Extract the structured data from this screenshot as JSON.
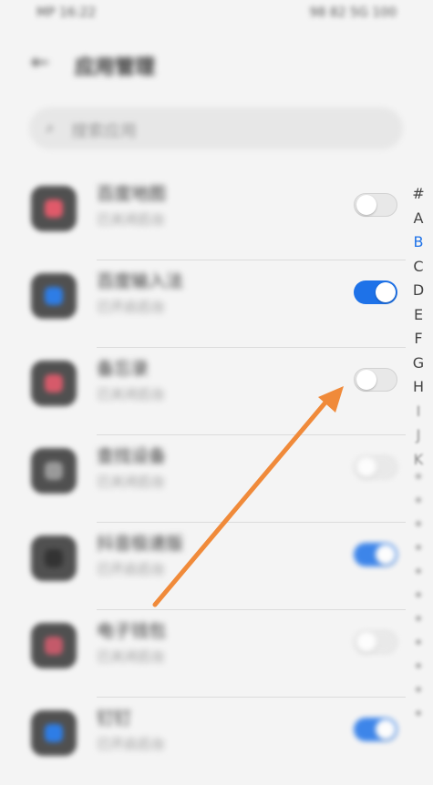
{
  "status_bar": {
    "left": "MP 16:22",
    "right": "98 82 5G 100"
  },
  "header": {
    "back_icon": "back-arrow-icon",
    "title": "应用管理"
  },
  "search": {
    "placeholder": "搜索应用"
  },
  "apps": [
    {
      "name": "百度地图",
      "sub": "已关闭后台",
      "enabled": false,
      "icon_color": "#e05a6a"
    },
    {
      "name": "百度输入法",
      "sub": "已开启后台",
      "enabled": true,
      "icon_color": "#2e7de6"
    },
    {
      "name": "备忘录",
      "sub": "已关闭后台",
      "enabled": false,
      "icon_color": "#d65a6a"
    },
    {
      "name": "查找设备",
      "sub": "已关闭后台",
      "enabled": false,
      "icon_color": "#9a9a9a"
    },
    {
      "name": "抖音极速版",
      "sub": "已开启后台",
      "enabled": true,
      "icon_color": "#333333"
    },
    {
      "name": "电子钱包",
      "sub": "已关闭后台",
      "enabled": false,
      "icon_color": "#c45a6a"
    },
    {
      "name": "钉钉",
      "sub": "已开启后台",
      "enabled": true,
      "icon_color": "#2e7de6"
    }
  ],
  "alphabet": [
    "#",
    "A",
    "B",
    "C",
    "D",
    "E",
    "F",
    "G",
    "H",
    "I",
    "J",
    "K"
  ],
  "alphabet_active": "B",
  "colors": {
    "accent": "#1e72e8",
    "annotation_arrow": "#f08a3a"
  }
}
